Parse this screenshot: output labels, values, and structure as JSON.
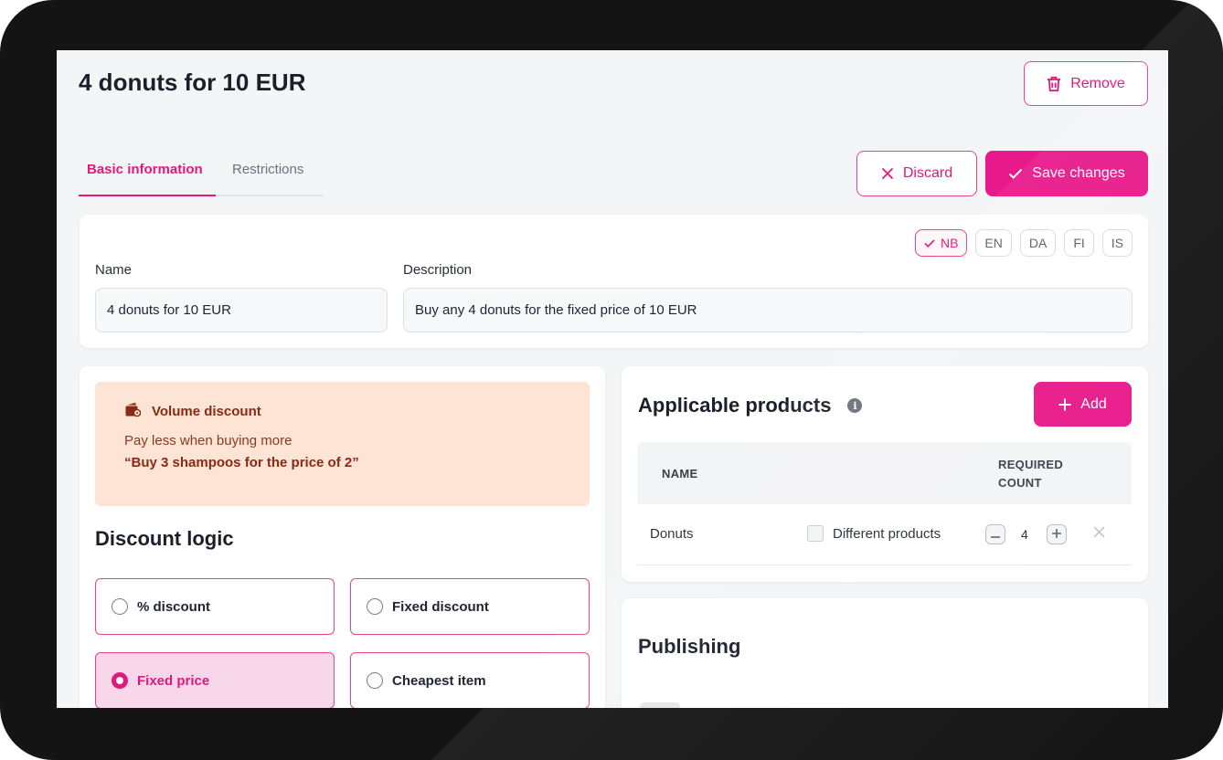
{
  "page": {
    "title": "4 donuts for 10 EUR",
    "remove_label": "Remove",
    "discard_label": "Discard",
    "save_label": "Save changes"
  },
  "tabs": [
    {
      "label": "Basic information",
      "active": true
    },
    {
      "label": "Restrictions",
      "active": false
    }
  ],
  "languages": [
    {
      "code": "NB",
      "selected": true
    },
    {
      "code": "EN",
      "selected": false
    },
    {
      "code": "DA",
      "selected": false
    },
    {
      "code": "FI",
      "selected": false
    },
    {
      "code": "IS",
      "selected": false
    }
  ],
  "form": {
    "name_label": "Name",
    "name_value": "4 donuts for 10 EUR",
    "description_label": "Description",
    "description_value": "Buy any 4 donuts for the fixed price of 10 EUR"
  },
  "promo": {
    "title": "Volume discount",
    "subtitle": "Pay less when buying more",
    "example": "“Buy 3 shampoos for the price of 2”",
    "icon": "wallet-icon"
  },
  "discount_logic": {
    "title": "Discount logic",
    "options": [
      {
        "label": "% discount",
        "selected": false
      },
      {
        "label": "Fixed discount",
        "selected": false
      },
      {
        "label": "Fixed price",
        "selected": true
      },
      {
        "label": "Cheapest item",
        "selected": false
      }
    ]
  },
  "applicable_products": {
    "title": "Applicable products",
    "add_label": "Add",
    "columns": {
      "name": "NAME",
      "required_count": "REQUIRED COUNT"
    },
    "rows": [
      {
        "name": "Donuts",
        "different_products_label": "Different products",
        "different_products": false,
        "count": "4"
      }
    ]
  },
  "publishing": {
    "title": "Publishing"
  },
  "colors": {
    "accent": "#e8198a",
    "promo_bg": "#fde4d4",
    "selected_option_bg": "#f8d7ea"
  }
}
